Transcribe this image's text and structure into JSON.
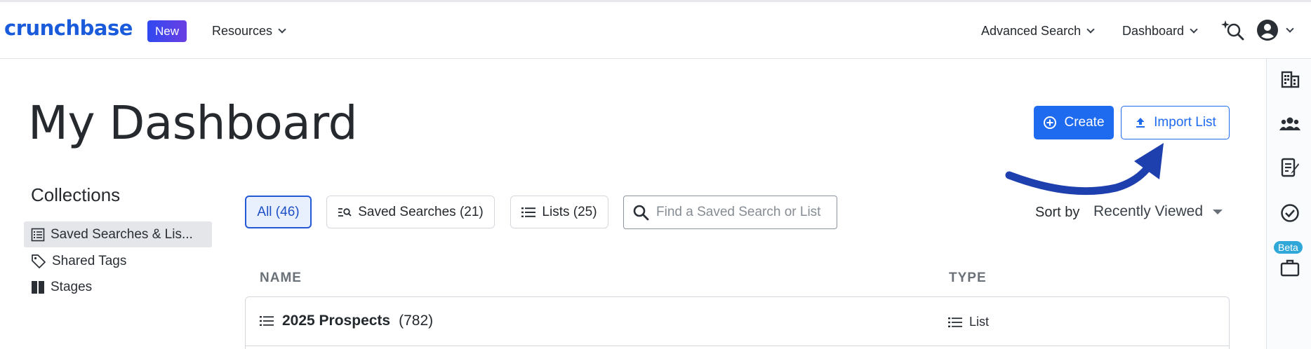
{
  "header": {
    "logo": "crunchbase",
    "new_badge": "New",
    "resources": "Resources",
    "advanced_search": "Advanced Search",
    "dashboard": "Dashboard",
    "icons": [
      "search-sparkle-icon",
      "account-icon"
    ]
  },
  "page": {
    "title": "My Dashboard",
    "create_label": "Create",
    "import_label": "Import List"
  },
  "collections": {
    "title": "Collections",
    "items": [
      {
        "label": "Saved Searches & Lis...",
        "icon": "list-box-icon",
        "active": true
      },
      {
        "label": "Shared Tags",
        "icon": "tag-icon",
        "active": false
      },
      {
        "label": "Stages",
        "icon": "columns-icon",
        "active": false
      }
    ]
  },
  "filters": {
    "all": "All (46)",
    "saved_searches": "Saved Searches (21)",
    "lists": "Lists (25)",
    "search_placeholder": "Find a Saved Search or List"
  },
  "sort": {
    "label": "Sort by",
    "value": "Recently Viewed"
  },
  "table": {
    "columns": [
      "NAME",
      "TYPE"
    ],
    "rows": [
      {
        "name": "2025 Prospects",
        "count": "(782)",
        "type": "List"
      }
    ]
  },
  "rail": {
    "icons": [
      "building-icon",
      "people-icon",
      "notes-icon",
      "check-circle-icon",
      "briefcase-icon"
    ],
    "beta": "Beta"
  },
  "colors": {
    "brand": "#1a5bdc",
    "primary": "#1f6bf0",
    "annotation_arrow": "#1e3fae"
  }
}
